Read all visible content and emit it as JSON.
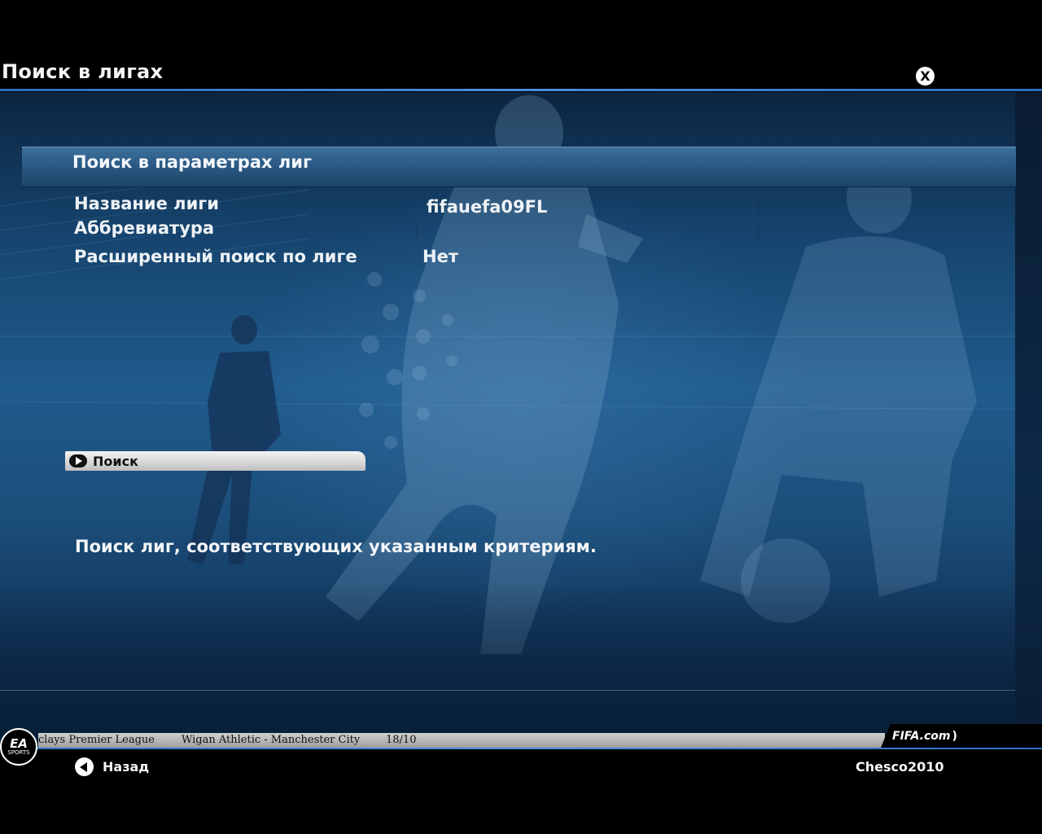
{
  "screen": {
    "title": "Поиск в лигах",
    "close_icon_label": "X"
  },
  "panel": {
    "title": "Поиск в параметрах лиг",
    "fields": [
      {
        "label": "Название лиги",
        "value": "fifauefa09FL"
      },
      {
        "label": "Аббревиатура",
        "value": ""
      },
      {
        "label": "Расширенный поиск по лиге",
        "value": "Нет"
      }
    ]
  },
  "actions": {
    "search_label": "Поиск"
  },
  "help_text": "Поиск лиг, соответствующих указанным критериям.",
  "ticker": {
    "league": "clays Premier League",
    "match": "Wigan Athletic - Manchester City",
    "score": "18/10"
  },
  "branding": {
    "fifa": "FIFA.com",
    "ea_top": "EA",
    "ea_bottom": "SPORTS"
  },
  "footer": {
    "back_label": "Назад",
    "user": "Chesco2010"
  },
  "colors": {
    "accent_line": "#3b82d6",
    "panel_header": "#2b5a85",
    "background": "#1b4e7a"
  }
}
